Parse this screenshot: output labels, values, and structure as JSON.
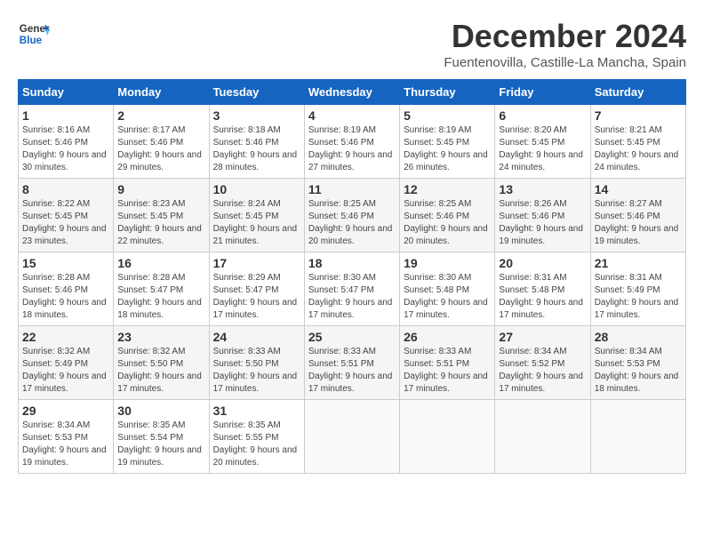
{
  "header": {
    "logo_line1": "General",
    "logo_line2": "Blue",
    "month_title": "December 2024",
    "location": "Fuentenovilla, Castille-La Mancha, Spain"
  },
  "days_of_week": [
    "Sunday",
    "Monday",
    "Tuesday",
    "Wednesday",
    "Thursday",
    "Friday",
    "Saturday"
  ],
  "weeks": [
    [
      {
        "day": "1",
        "sunrise": "8:16 AM",
        "sunset": "5:46 PM",
        "daylight": "9 hours and 30 minutes."
      },
      {
        "day": "2",
        "sunrise": "8:17 AM",
        "sunset": "5:46 PM",
        "daylight": "9 hours and 29 minutes."
      },
      {
        "day": "3",
        "sunrise": "8:18 AM",
        "sunset": "5:46 PM",
        "daylight": "9 hours and 28 minutes."
      },
      {
        "day": "4",
        "sunrise": "8:19 AM",
        "sunset": "5:46 PM",
        "daylight": "9 hours and 27 minutes."
      },
      {
        "day": "5",
        "sunrise": "8:19 AM",
        "sunset": "5:45 PM",
        "daylight": "9 hours and 26 minutes."
      },
      {
        "day": "6",
        "sunrise": "8:20 AM",
        "sunset": "5:45 PM",
        "daylight": "9 hours and 24 minutes."
      },
      {
        "day": "7",
        "sunrise": "8:21 AM",
        "sunset": "5:45 PM",
        "daylight": "9 hours and 24 minutes."
      }
    ],
    [
      {
        "day": "8",
        "sunrise": "8:22 AM",
        "sunset": "5:45 PM",
        "daylight": "9 hours and 23 minutes."
      },
      {
        "day": "9",
        "sunrise": "8:23 AM",
        "sunset": "5:45 PM",
        "daylight": "9 hours and 22 minutes."
      },
      {
        "day": "10",
        "sunrise": "8:24 AM",
        "sunset": "5:45 PM",
        "daylight": "9 hours and 21 minutes."
      },
      {
        "day": "11",
        "sunrise": "8:25 AM",
        "sunset": "5:46 PM",
        "daylight": "9 hours and 20 minutes."
      },
      {
        "day": "12",
        "sunrise": "8:25 AM",
        "sunset": "5:46 PM",
        "daylight": "9 hours and 20 minutes."
      },
      {
        "day": "13",
        "sunrise": "8:26 AM",
        "sunset": "5:46 PM",
        "daylight": "9 hours and 19 minutes."
      },
      {
        "day": "14",
        "sunrise": "8:27 AM",
        "sunset": "5:46 PM",
        "daylight": "9 hours and 19 minutes."
      }
    ],
    [
      {
        "day": "15",
        "sunrise": "8:28 AM",
        "sunset": "5:46 PM",
        "daylight": "9 hours and 18 minutes."
      },
      {
        "day": "16",
        "sunrise": "8:28 AM",
        "sunset": "5:47 PM",
        "daylight": "9 hours and 18 minutes."
      },
      {
        "day": "17",
        "sunrise": "8:29 AM",
        "sunset": "5:47 PM",
        "daylight": "9 hours and 17 minutes."
      },
      {
        "day": "18",
        "sunrise": "8:30 AM",
        "sunset": "5:47 PM",
        "daylight": "9 hours and 17 minutes."
      },
      {
        "day": "19",
        "sunrise": "8:30 AM",
        "sunset": "5:48 PM",
        "daylight": "9 hours and 17 minutes."
      },
      {
        "day": "20",
        "sunrise": "8:31 AM",
        "sunset": "5:48 PM",
        "daylight": "9 hours and 17 minutes."
      },
      {
        "day": "21",
        "sunrise": "8:31 AM",
        "sunset": "5:49 PM",
        "daylight": "9 hours and 17 minutes."
      }
    ],
    [
      {
        "day": "22",
        "sunrise": "8:32 AM",
        "sunset": "5:49 PM",
        "daylight": "9 hours and 17 minutes."
      },
      {
        "day": "23",
        "sunrise": "8:32 AM",
        "sunset": "5:50 PM",
        "daylight": "9 hours and 17 minutes."
      },
      {
        "day": "24",
        "sunrise": "8:33 AM",
        "sunset": "5:50 PM",
        "daylight": "9 hours and 17 minutes."
      },
      {
        "day": "25",
        "sunrise": "8:33 AM",
        "sunset": "5:51 PM",
        "daylight": "9 hours and 17 minutes."
      },
      {
        "day": "26",
        "sunrise": "8:33 AM",
        "sunset": "5:51 PM",
        "daylight": "9 hours and 17 minutes."
      },
      {
        "day": "27",
        "sunrise": "8:34 AM",
        "sunset": "5:52 PM",
        "daylight": "9 hours and 17 minutes."
      },
      {
        "day": "28",
        "sunrise": "8:34 AM",
        "sunset": "5:53 PM",
        "daylight": "9 hours and 18 minutes."
      }
    ],
    [
      {
        "day": "29",
        "sunrise": "8:34 AM",
        "sunset": "5:53 PM",
        "daylight": "9 hours and 19 minutes."
      },
      {
        "day": "30",
        "sunrise": "8:35 AM",
        "sunset": "5:54 PM",
        "daylight": "9 hours and 19 minutes."
      },
      {
        "day": "31",
        "sunrise": "8:35 AM",
        "sunset": "5:55 PM",
        "daylight": "9 hours and 20 minutes."
      },
      null,
      null,
      null,
      null
    ]
  ]
}
